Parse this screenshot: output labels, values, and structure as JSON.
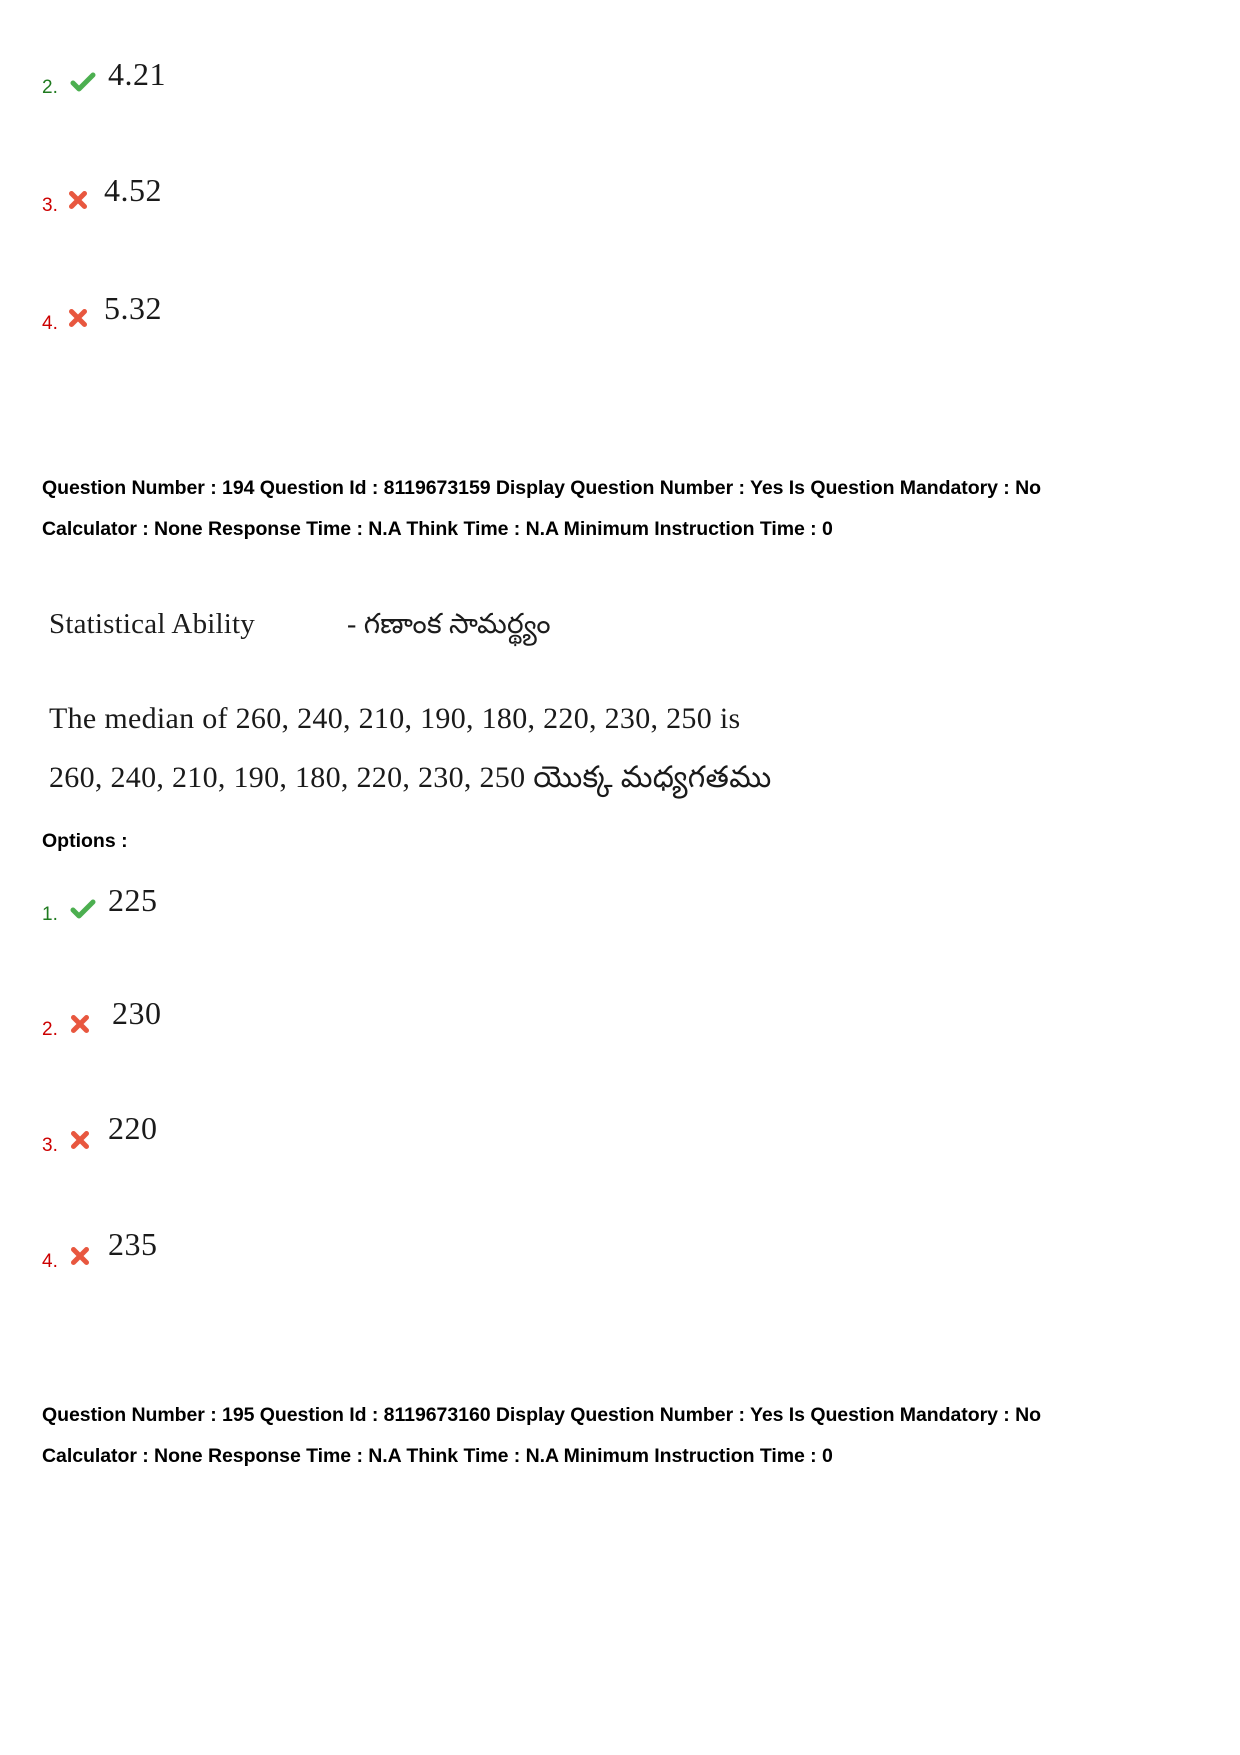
{
  "page": {
    "background": "#ffffff",
    "correct_color": "#1f7a1f",
    "wrong_color": "#cc0000",
    "check_icon_color": "#4caf50",
    "cross_icon_color": "#e8573f"
  },
  "previous_question_options": [
    {
      "number": "2.",
      "value": "4.21",
      "state": "correct",
      "icon": "check-mark-icon"
    },
    {
      "number": "3.",
      "value": "4.52",
      "state": "wrong",
      "icon": "cross-mark-icon"
    },
    {
      "number": "4.",
      "value": "5.32",
      "state": "wrong",
      "icon": "cross-mark-icon"
    }
  ],
  "question_194": {
    "meta": "Question Number : 194 Question Id : 8119673159 Display Question Number : Yes Is Question Mandatory : No Calculator : None Response Time : N.A Think Time : N.A Minimum Instruction Time : 0",
    "subject_english": "Statistical Ability",
    "subject_telugu": "- గణాంక సామర్థ్యం",
    "text_english": "The median of 260, 240, 210, 190, 180, 220, 230, 250 is",
    "text_telugu": "260, 240, 210, 190, 180, 220, 230, 250 యొక్క మధ్యగతము",
    "options_label": "Options :",
    "options": [
      {
        "number": "1.",
        "value": "225",
        "state": "correct",
        "icon": "check-mark-icon"
      },
      {
        "number": "2.",
        "value": "230",
        "state": "wrong",
        "icon": "cross-mark-icon"
      },
      {
        "number": "3.",
        "value": "220",
        "state": "wrong",
        "icon": "cross-mark-icon"
      },
      {
        "number": "4.",
        "value": "235",
        "state": "wrong",
        "icon": "cross-mark-icon"
      }
    ]
  },
  "question_195": {
    "meta": "Question Number : 195 Question Id : 8119673160 Display Question Number : Yes Is Question Mandatory : No Calculator : None Response Time : N.A Think Time : N.A Minimum Instruction Time : 0"
  }
}
